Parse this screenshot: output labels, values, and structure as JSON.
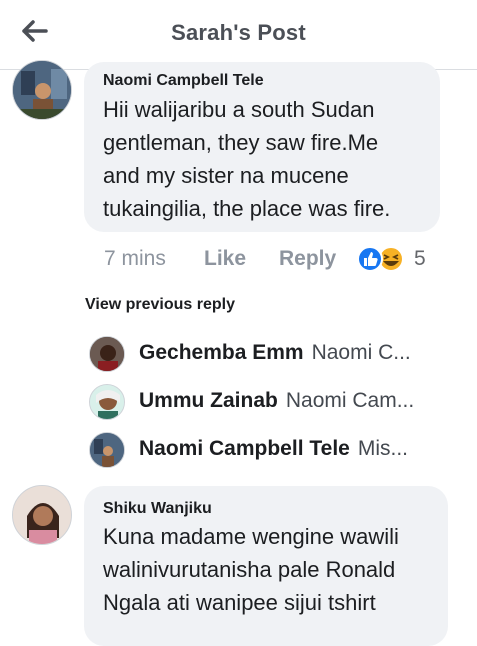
{
  "header": {
    "title": "Sarah's Post",
    "back_icon": "arrow-left-icon"
  },
  "comment1": {
    "author": "Naomi Campbell Tele",
    "lines": [
      "Hii walijaribu a south Sudan",
      "gentleman, they saw fire.Me",
      "and my sister na mucene",
      "tukaingilia, the place was fire."
    ],
    "time": "7 mins",
    "like_label": "Like",
    "reply_label": "Reply",
    "reaction_icons": [
      "like-reaction-icon",
      "haha-reaction-icon"
    ],
    "reaction_count": "5"
  },
  "view_previous_label": "View previous reply",
  "replies": [
    {
      "author": "Gechemba Emm",
      "snippet": "Naomi C..."
    },
    {
      "author": "Ummu Zainab",
      "snippet": "Naomi Cam..."
    },
    {
      "author": "Naomi Campbell Tele",
      "snippet": "Mis..."
    }
  ],
  "comment2": {
    "author": "Shiku Wanjiku",
    "lines": [
      "Kuna madame wengine wawili",
      "walinivurutanisha pale Ronald",
      "Ngala ati wanipee sijui tshirt"
    ]
  },
  "colors": {
    "bubble": "#f0f2f5",
    "muted": "#8d949e",
    "like_blue": "#1877f2",
    "haha_yellow": "#f7b125"
  }
}
